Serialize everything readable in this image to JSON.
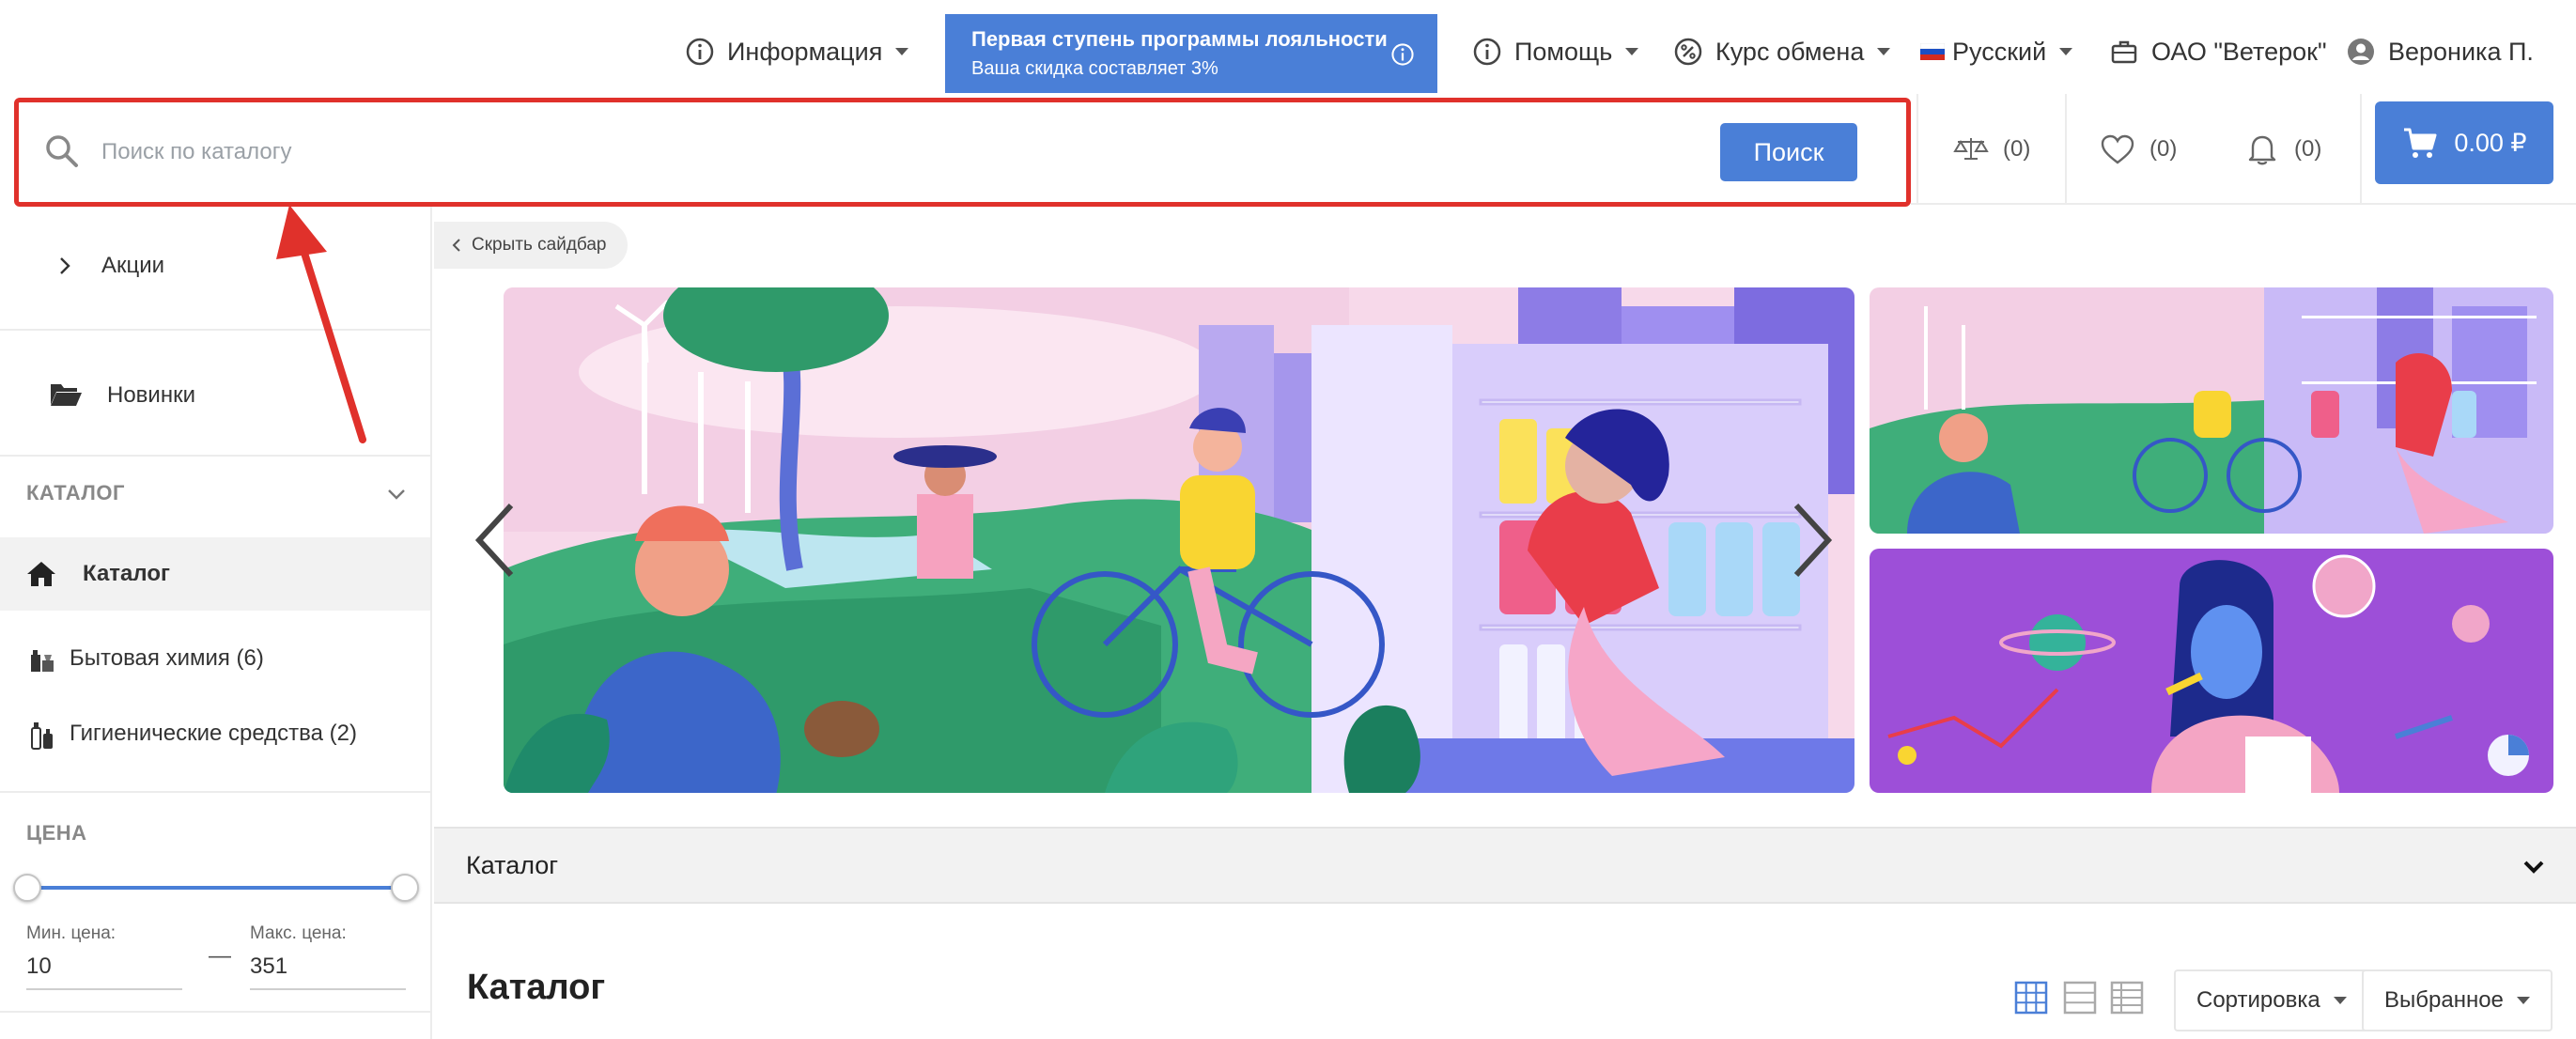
{
  "header": {
    "info_menu": "Информация",
    "loyalty": {
      "title": "Первая ступень программы лояльности",
      "subtitle": "Ваша скидка составляет 3%"
    },
    "help_menu": "Помощь",
    "exchange_menu": "Курс обмена",
    "language": "Русский",
    "company": "ОАО \"Ветерок\"",
    "user": "Вероника П."
  },
  "search": {
    "placeholder": "Поиск по каталогу",
    "button": "Поиск"
  },
  "counters": {
    "compare": "(0)",
    "favorites": "(0)",
    "notifications": "(0)",
    "cart_total": "0.00 ₽"
  },
  "sidebar": {
    "promo": "Акции",
    "new": "Новинки",
    "catalog_heading": "КАТАЛОГ",
    "catalog_link": "Каталог",
    "categories": [
      {
        "label": "Бытовая химия (6)"
      },
      {
        "label": "Гигиенические средства (2)"
      }
    ],
    "price_heading": "ЦЕНА",
    "min_label": "Мин. цена:",
    "max_label": "Макс. цена:",
    "min_value": "10",
    "max_value": "351",
    "dash": "—"
  },
  "main": {
    "hide_sidebar": "Скрыть сайдбар",
    "catalog_bar": "Каталог",
    "page_title": "Каталог",
    "sort_label": "Сортировка",
    "filter_label": "Выбранное"
  },
  "colors": {
    "accent": "#4a7fd7",
    "annotation": "#e0312b"
  }
}
